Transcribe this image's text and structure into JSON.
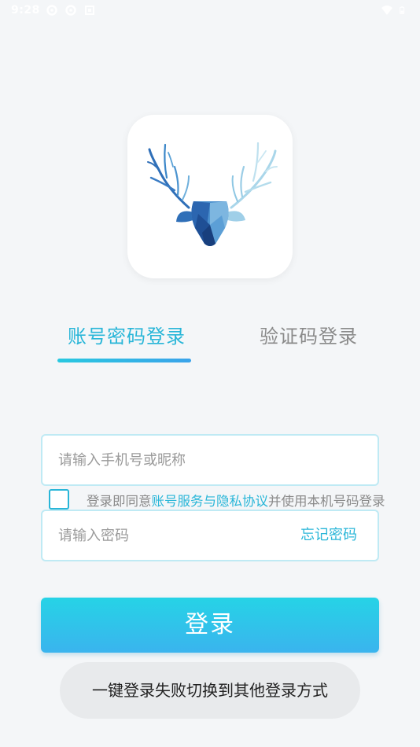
{
  "status_bar": {
    "time": "9:28",
    "left_icons": [
      "gear-icon",
      "gear-icon",
      "square-icon"
    ],
    "right_icons": [
      "wifi-icon",
      "battery-icon"
    ]
  },
  "tabs": {
    "password_label": "账号密码登录",
    "code_label": "验证码登录",
    "active": "password"
  },
  "phone_field": {
    "placeholder": "请输入手机号或昵称",
    "value": ""
  },
  "agreement": {
    "checked": false,
    "prefix": "登录即同意",
    "link": "账号服务与隐私协议",
    "suffix": "并使用本机号码登录"
  },
  "password_field": {
    "placeholder": "请输入密码",
    "value": "",
    "forgot_label": "忘记密码"
  },
  "login_button": {
    "label": "登录"
  },
  "alt_button": {
    "label": "一键登录失败切换到其他登录方式"
  },
  "colors": {
    "accent": "#29b6d8",
    "background": "#f4f6f8",
    "button_gradient_top": "#26d3e6",
    "button_gradient_bottom": "#3ab4ee"
  }
}
